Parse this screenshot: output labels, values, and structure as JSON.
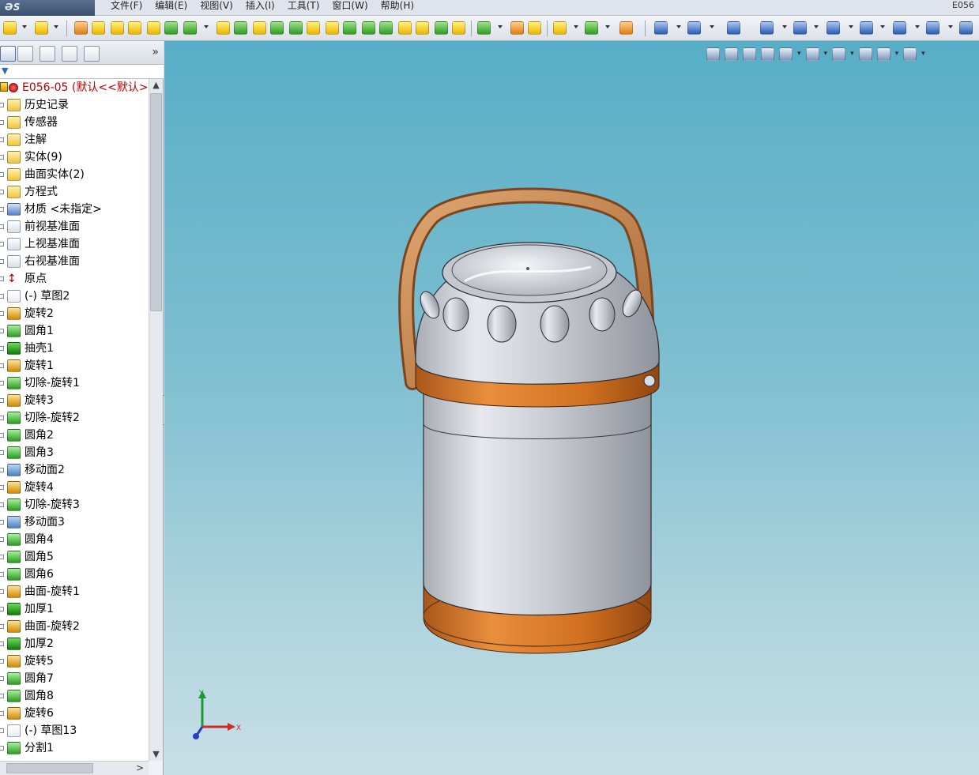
{
  "app": {
    "logo": "ƏS SOLIDWORKS",
    "window_title_fragment": "E056"
  },
  "menu": [
    "文件(F)",
    "编辑(E)",
    "视图(V)",
    "插入(I)",
    "工具(T)",
    "窗口(W)",
    "帮助(H)"
  ],
  "tree": {
    "root": "E056-05  (默认<<默认>",
    "items": [
      {
        "label": "历史记录",
        "icon": "history-folder-icon",
        "kind": "ifold"
      },
      {
        "label": "传感器",
        "icon": "sensor-folder-icon",
        "kind": "ifold"
      },
      {
        "label": "注解",
        "icon": "annotation-folder-icon",
        "kind": "ifold"
      },
      {
        "label": "实体(9)",
        "icon": "solid-bodies-folder-icon",
        "kind": "ifold"
      },
      {
        "label": "曲面实体(2)",
        "icon": "surface-bodies-folder-icon",
        "kind": "ifold"
      },
      {
        "label": "方程式",
        "icon": "equations-folder-icon",
        "kind": "ifold"
      },
      {
        "label": "材质 <未指定>",
        "icon": "material-icon",
        "kind": "imat"
      },
      {
        "label": "前视基准面",
        "icon": "plane-icon",
        "kind": "iplane"
      },
      {
        "label": "上视基准面",
        "icon": "plane-icon",
        "kind": "iplane"
      },
      {
        "label": "右视基准面",
        "icon": "plane-icon",
        "kind": "iplane"
      },
      {
        "label": "原点",
        "icon": "origin-icon",
        "kind": "iorigin"
      },
      {
        "label": "(-) 草图2",
        "icon": "sketch-icon",
        "kind": "isketch"
      },
      {
        "label": "旋转2",
        "icon": "revolve-icon",
        "kind": "irev"
      },
      {
        "label": "圆角1",
        "icon": "fillet-icon",
        "kind": "ifeat"
      },
      {
        "label": "抽壳1",
        "icon": "shell-icon",
        "kind": "ishell"
      },
      {
        "label": "旋转1",
        "icon": "revolve-icon",
        "kind": "irev"
      },
      {
        "label": "切除-旋转1",
        "icon": "cut-revolve-icon",
        "kind": "ifeat"
      },
      {
        "label": "旋转3",
        "icon": "revolve-icon",
        "kind": "irev"
      },
      {
        "label": "切除-旋转2",
        "icon": "cut-revolve-icon",
        "kind": "ifeat"
      },
      {
        "label": "圆角2",
        "icon": "fillet-icon",
        "kind": "ifeat"
      },
      {
        "label": "圆角3",
        "icon": "fillet-icon",
        "kind": "ifeat"
      },
      {
        "label": "移动面2",
        "icon": "move-face-icon",
        "kind": "imove"
      },
      {
        "label": "旋转4",
        "icon": "revolve-icon",
        "kind": "irev"
      },
      {
        "label": "切除-旋转3",
        "icon": "cut-revolve-icon",
        "kind": "ifeat"
      },
      {
        "label": "移动面3",
        "icon": "move-face-icon",
        "kind": "imove"
      },
      {
        "label": "圆角4",
        "icon": "fillet-icon",
        "kind": "ifeat"
      },
      {
        "label": "圆角5",
        "icon": "fillet-icon",
        "kind": "ifeat"
      },
      {
        "label": "圆角6",
        "icon": "fillet-icon",
        "kind": "ifeat"
      },
      {
        "label": "曲面-旋转1",
        "icon": "surface-revolve-icon",
        "kind": "irev"
      },
      {
        "label": "加厚1",
        "icon": "thicken-icon",
        "kind": "ishell"
      },
      {
        "label": "曲面-旋转2",
        "icon": "surface-revolve-icon",
        "kind": "irev"
      },
      {
        "label": "加厚2",
        "icon": "thicken-icon",
        "kind": "ishell"
      },
      {
        "label": "旋转5",
        "icon": "revolve-icon",
        "kind": "irev"
      },
      {
        "label": "圆角7",
        "icon": "fillet-icon",
        "kind": "ifeat"
      },
      {
        "label": "圆角8",
        "icon": "fillet-icon",
        "kind": "ifeat"
      },
      {
        "label": "旋转6",
        "icon": "revolve-icon",
        "kind": "irev"
      },
      {
        "label": "(-) 草图13",
        "icon": "sketch-icon",
        "kind": "isketch"
      },
      {
        "label": "分割1",
        "icon": "split-icon",
        "kind": "ifeat"
      }
    ]
  },
  "triad": {
    "x": "X",
    "y": "Y"
  },
  "colors": {
    "accent_red": "#c00000",
    "body_silver": "#c8cbd1",
    "band_orange": "#d9782a",
    "handle_orange": "#c8864e",
    "viewport_top": "#57aec7"
  }
}
